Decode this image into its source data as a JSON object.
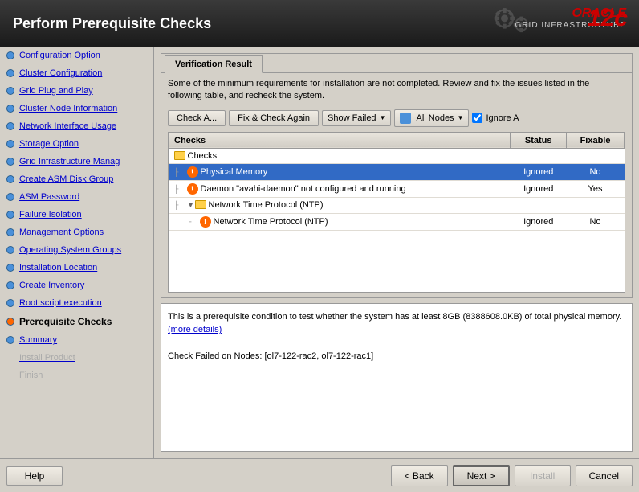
{
  "header": {
    "title": "Perform Prerequisite Checks",
    "oracle_text": "ORACLE",
    "product_text": "GRID INFRASTRUCTURE",
    "version": "12c"
  },
  "sidebar": {
    "items": [
      {
        "id": "config-option",
        "label": "Configuration Option",
        "state": "link"
      },
      {
        "id": "cluster-config",
        "label": "Cluster Configuration",
        "state": "link"
      },
      {
        "id": "grid-plug-play",
        "label": "Grid Plug and Play",
        "state": "link"
      },
      {
        "id": "cluster-node-info",
        "label": "Cluster Node Information",
        "state": "link"
      },
      {
        "id": "network-interface",
        "label": "Network Interface Usage",
        "state": "link"
      },
      {
        "id": "storage-option",
        "label": "Storage Option",
        "state": "link"
      },
      {
        "id": "grid-infra-manage",
        "label": "Grid Infrastructure Manag",
        "state": "link"
      },
      {
        "id": "create-asm-disk",
        "label": "Create ASM Disk Group",
        "state": "link"
      },
      {
        "id": "asm-password",
        "label": "ASM Password",
        "state": "link"
      },
      {
        "id": "failure-isolation",
        "label": "Failure Isolation",
        "state": "link"
      },
      {
        "id": "management-options",
        "label": "Management Options",
        "state": "link"
      },
      {
        "id": "os-groups",
        "label": "Operating System Groups",
        "state": "link"
      },
      {
        "id": "install-location",
        "label": "Installation Location",
        "state": "link"
      },
      {
        "id": "create-inventory",
        "label": "Create Inventory",
        "state": "link"
      },
      {
        "id": "root-script",
        "label": "Root script execution",
        "state": "link"
      },
      {
        "id": "prereq-checks",
        "label": "Prerequisite Checks",
        "state": "active"
      },
      {
        "id": "summary",
        "label": "Summary",
        "state": "link"
      },
      {
        "id": "install-product",
        "label": "Install Product",
        "state": "disabled"
      },
      {
        "id": "finish",
        "label": "Finish",
        "state": "disabled"
      }
    ]
  },
  "tab": {
    "label": "Verification Result",
    "description": "Some of the minimum requirements for installation are not completed. Review and fix the issues listed in the following table, and recheck the system."
  },
  "toolbar": {
    "check_all_label": "Check A...",
    "fix_check_label": "Fix & Check Again",
    "show_failed_label": "Show Failed",
    "all_nodes_label": "All Nodes",
    "ignore_label": "Ignore A"
  },
  "table": {
    "headers": [
      "Checks",
      "Status",
      "Fixable"
    ],
    "rows": [
      {
        "id": "checks-group",
        "type": "group",
        "label": "Checks",
        "icon": "folder",
        "indent": 0,
        "status": "",
        "fixable": ""
      },
      {
        "id": "physical-memory",
        "type": "item",
        "label": "Physical Memory",
        "icon": "warning",
        "indent": 1,
        "status": "Ignored",
        "fixable": "No",
        "selected": true
      },
      {
        "id": "avahi-daemon",
        "type": "item",
        "label": "Daemon \"avahi-daemon\" not configured and running",
        "icon": "warning",
        "indent": 1,
        "status": "Ignored",
        "fixable": "Yes",
        "selected": false
      },
      {
        "id": "ntp-group",
        "type": "group",
        "label": "Network Time Protocol (NTP)",
        "icon": "folder",
        "indent": 1,
        "status": "",
        "fixable": "",
        "selected": false,
        "collapsed": false
      },
      {
        "id": "ntp-item",
        "type": "item",
        "label": "Network Time Protocol (NTP)",
        "icon": "warning",
        "indent": 2,
        "status": "Ignored",
        "fixable": "No",
        "selected": false
      }
    ]
  },
  "description": {
    "text": "This is a prerequisite condition to test whether the system has at least 8GB (8388608.0KB) of total physical memory.",
    "link_text": "(more details)",
    "failed_nodes_label": "Check Failed on Nodes: [ol7-122-rac2, ol7-122-rac1]"
  },
  "bottom_buttons": {
    "help": "Help",
    "back": "< Back",
    "next": "Next >",
    "install": "Install",
    "cancel": "Cancel"
  }
}
